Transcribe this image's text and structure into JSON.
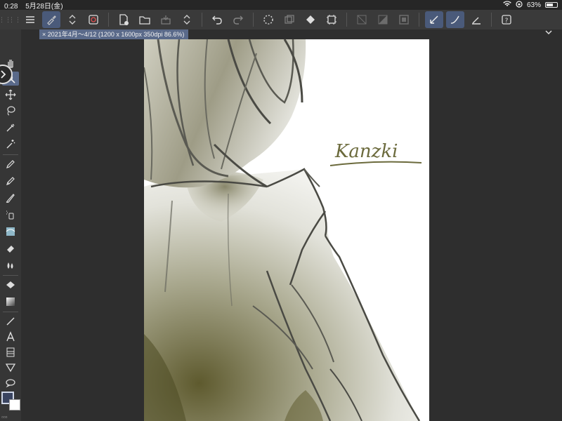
{
  "status_bar": {
    "time": "0:28",
    "date": "5月28日(金)",
    "battery_percent": "63%",
    "battery_level": 0.63
  },
  "toolbar": {
    "icons": [
      "menu-icon",
      "brush-icon",
      "updown-icon",
      "layer-icon",
      "new-file-icon",
      "open-folder-icon",
      "save-icon",
      "updown-icon",
      "undo-icon",
      "redo-icon",
      "loading-icon",
      "copy-icon",
      "fill-icon",
      "transform-icon",
      "hide-icon",
      "layer-clip-icon",
      "frame-icon",
      "ruler-icon",
      "brush-stroke-icon",
      "pen-line-icon",
      "help-icon"
    ]
  },
  "document_tab": {
    "title": "2021年4月～4/12 (1200 x 1600px 350dpi 86.6%)",
    "close_glyph": "×"
  },
  "canvas": {
    "signature_text": "Kanzki"
  },
  "colors": {
    "main_color": "#3a4460",
    "sub_color": "#ffffff",
    "accent": "#5a6a8a",
    "ink": "#4a4a44",
    "shade": "#6b6a3c"
  }
}
